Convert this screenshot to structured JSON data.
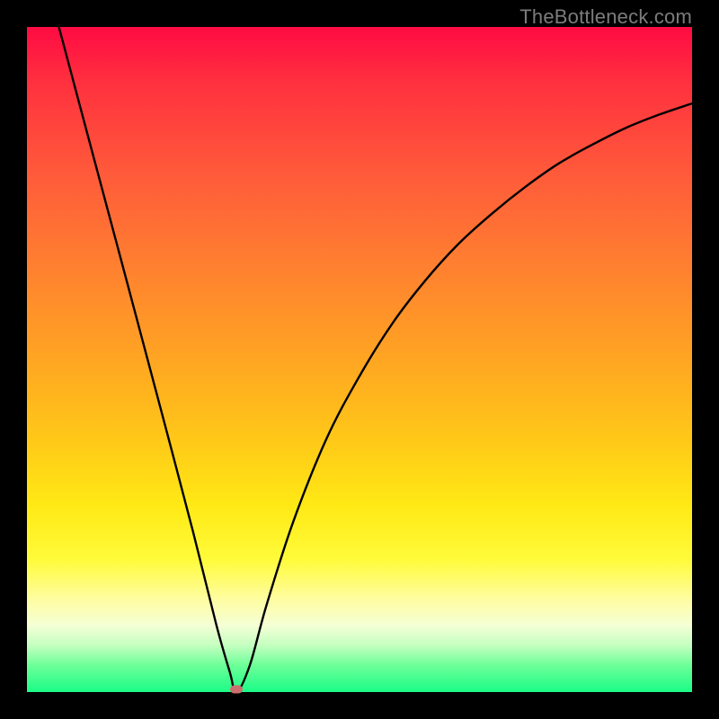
{
  "watermark": "TheBottleneck.com",
  "colors": {
    "frame": "#000000",
    "curve": "#000000",
    "marker": "#cb6f6e",
    "gradient_stops": [
      "#ff0b43",
      "#ff2f3f",
      "#ff5a3a",
      "#ff8030",
      "#ffa522",
      "#ffc818",
      "#ffe915",
      "#fffb3a",
      "#fffda0",
      "#f4ffd6",
      "#c4ffc0",
      "#6cff98",
      "#1bfc87"
    ]
  },
  "chart_data": {
    "type": "line",
    "title": "",
    "xlabel": "",
    "ylabel": "",
    "xlim": [
      0,
      1
    ],
    "ylim": [
      0,
      1
    ],
    "notes": "Axes unlabeled in image; x and y normalized to plot area. Curve is V-shaped with minimum near x≈0.31, y≈0. Left branch nearly linear, right branch concave (diminishing slope).",
    "series": [
      {
        "name": "curve",
        "x": [
          0.048,
          0.1,
          0.15,
          0.2,
          0.25,
          0.285,
          0.305,
          0.315,
          0.335,
          0.36,
          0.4,
          0.45,
          0.5,
          0.55,
          0.6,
          0.65,
          0.7,
          0.75,
          0.8,
          0.85,
          0.9,
          0.95,
          1.0
        ],
        "y": [
          1.0,
          0.805,
          0.618,
          0.43,
          0.24,
          0.1,
          0.03,
          0.0,
          0.04,
          0.13,
          0.255,
          0.38,
          0.475,
          0.555,
          0.62,
          0.675,
          0.72,
          0.76,
          0.795,
          0.823,
          0.848,
          0.868,
          0.885
        ]
      }
    ],
    "marker": {
      "x": 0.315,
      "y": 0.0
    }
  }
}
